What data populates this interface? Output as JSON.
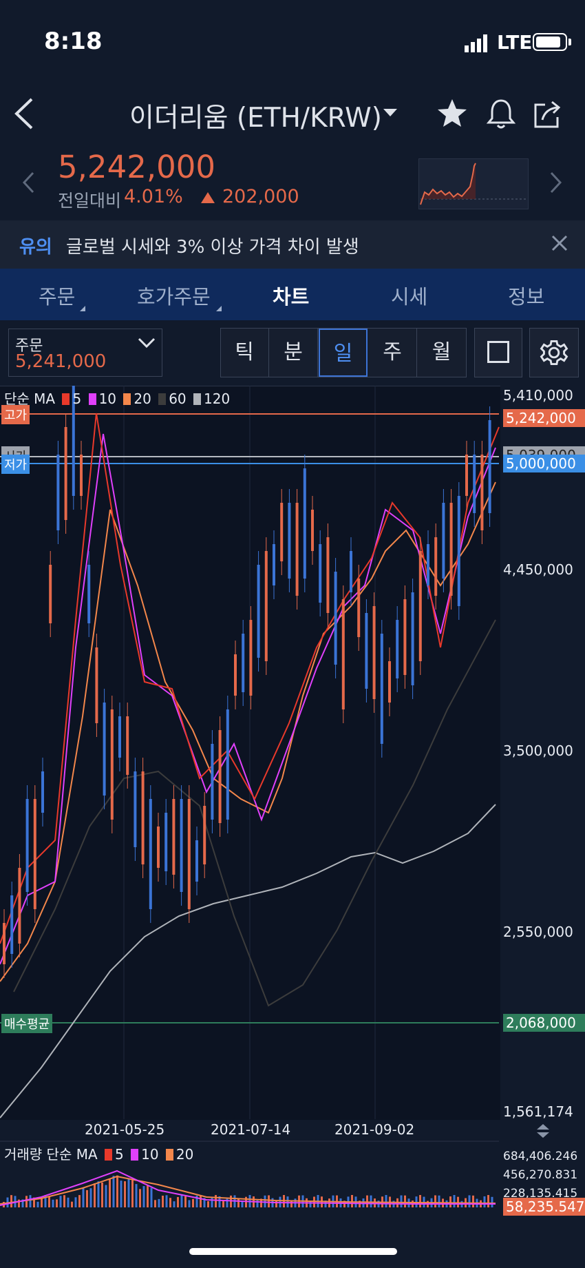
{
  "status": {
    "time": "8:18",
    "network": "LTE"
  },
  "header": {
    "title": "이더리움 (ETH/KRW)"
  },
  "quote": {
    "price": "5,242,000",
    "prev_label": "전일대비",
    "change_pct": "4.01%",
    "change_amount": "202,000",
    "color_up": "#e5694a"
  },
  "notice": {
    "tag": "유의",
    "text": "글로벌 시세와 3% 이상 가격 차이 발생"
  },
  "tabs": [
    {
      "label": "주문"
    },
    {
      "label": "호가주문"
    },
    {
      "label": "차트"
    },
    {
      "label": "시세"
    },
    {
      "label": "정보"
    }
  ],
  "toolbar": {
    "order_label": "주문",
    "order_value": "5,241,000",
    "periods": [
      "틱",
      "분",
      "일",
      "주",
      "월"
    ],
    "active_period": "일"
  },
  "chart_data": {
    "type": "candlestick",
    "ma_legend": {
      "prefix": "단순 MA",
      "periods": [
        "5",
        "10",
        "20",
        "60",
        "120"
      ],
      "colors": [
        "#e8392b",
        "#e040fb",
        "#f4874b",
        "#3c3c3c",
        "#b0b4ba"
      ]
    },
    "y_ticks": [
      "5,410,000",
      "4,450,000",
      "3,500,000",
      "2,550,000",
      "1,561,174"
    ],
    "x_ticks": [
      "2021-05-25",
      "2021-07-14",
      "2021-09-02"
    ],
    "high": {
      "label": "고가",
      "value": "5,242,000",
      "color": "#e5694a"
    },
    "low": {
      "label": "저가",
      "value": "5,000,000",
      "color": "#3b8fe6"
    },
    "prev": {
      "label": "시가",
      "value": "5,039,000"
    },
    "avg_buy": {
      "label": "매수평균",
      "value": "2,068,000",
      "color": "#2e7d5b"
    },
    "ylim": [
      1561174,
      5410000
    ]
  },
  "volume": {
    "legend_prefix": "거래량 단순 MA",
    "legend_periods": [
      "5",
      "10",
      "20"
    ],
    "ticks": [
      "684,406.246",
      "456,270.831",
      "228,135.415"
    ],
    "current": "58,235.547"
  }
}
